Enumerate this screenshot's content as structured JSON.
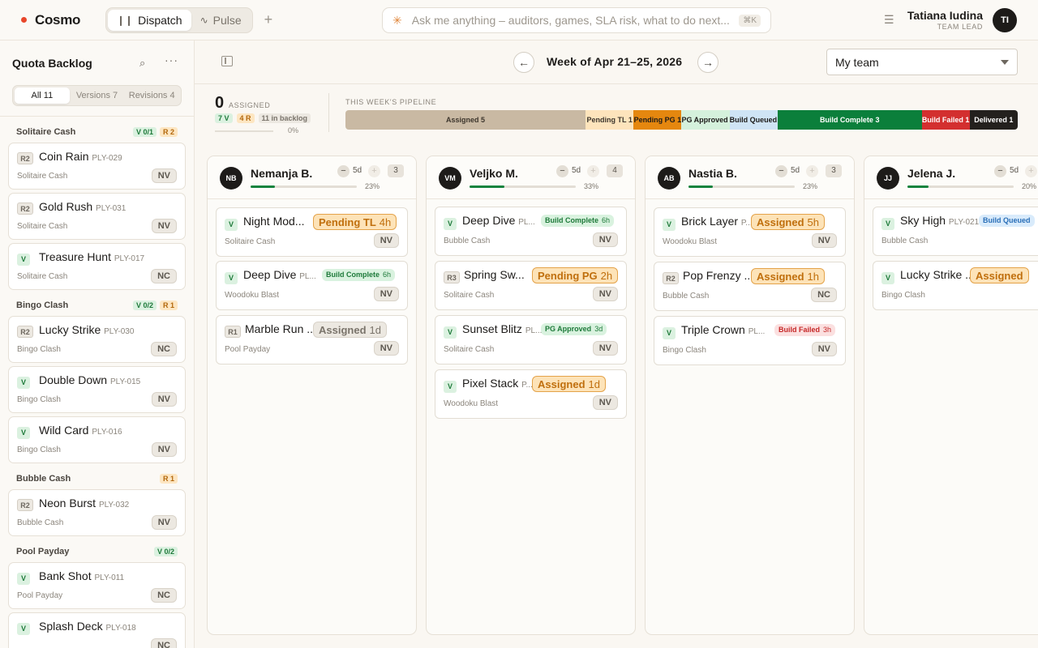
{
  "app": {
    "name": "Cosmo"
  },
  "mode_tabs": [
    {
      "label": "Dispatch",
      "icon": "bars-icon"
    },
    {
      "label": "Pulse",
      "icon": "pulse-icon"
    }
  ],
  "add_tab": "+",
  "search": {
    "placeholder": "Ask me anything – auditors, games, SLA risk, what to do next...",
    "shortcut": "⌘K"
  },
  "user": {
    "name": "Tatiana Iudina",
    "role": "TEAM LEAD",
    "initials": "TI"
  },
  "sidebar": {
    "title": "Quota Backlog",
    "filters": [
      "All 11",
      "Versions 7",
      "Revisions 4"
    ],
    "groups": [
      {
        "name": "Solitaire Cash",
        "badges": [
          {
            "type": "v",
            "text": "V 0/1"
          },
          {
            "type": "r",
            "text": "R 2"
          }
        ],
        "items": [
          {
            "tag": "R2",
            "title": "Coin Rain",
            "code": "PLY-029",
            "game": "Solitaire Cash",
            "pill": "NV"
          },
          {
            "tag": "R2",
            "title": "Gold Rush",
            "code": "PLY-031",
            "game": "Solitaire Cash",
            "pill": "NV"
          },
          {
            "tag": "V",
            "title": "Treasure Hunt",
            "code": "PLY-017",
            "game": "Solitaire Cash",
            "pill": "NC"
          }
        ]
      },
      {
        "name": "Bingo Clash",
        "badges": [
          {
            "type": "v",
            "text": "V 0/2"
          },
          {
            "type": "r",
            "text": "R 1"
          }
        ],
        "items": [
          {
            "tag": "R2",
            "title": "Lucky Strike",
            "code": "PLY-030",
            "game": "Bingo Clash",
            "pill": "NC"
          },
          {
            "tag": "V",
            "title": "Double Down",
            "code": "PLY-015",
            "game": "Bingo Clash",
            "pill": "NV"
          },
          {
            "tag": "V",
            "title": "Wild Card",
            "code": "PLY-016",
            "game": "Bingo Clash",
            "pill": "NV"
          }
        ]
      },
      {
        "name": "Bubble Cash",
        "badges": [
          {
            "type": "r",
            "text": "R 1"
          }
        ],
        "items": [
          {
            "tag": "R2",
            "title": "Neon Burst",
            "code": "PLY-032",
            "game": "Bubble Cash",
            "pill": "NV"
          }
        ]
      },
      {
        "name": "Pool Payday",
        "badges": [
          {
            "type": "v",
            "text": "V 0/2"
          }
        ],
        "items": [
          {
            "tag": "V",
            "title": "Bank Shot",
            "code": "PLY-011",
            "game": "Pool Payday",
            "pill": "NC"
          },
          {
            "tag": "V",
            "title": "Splash Deck",
            "code": "PLY-018",
            "game": "",
            "pill": "NC"
          }
        ]
      }
    ]
  },
  "week": {
    "label": "Week of Apr 21–25, 2026",
    "prev": "←",
    "next": "→"
  },
  "team_select": {
    "value": "My team"
  },
  "assigned": {
    "count": "0",
    "label": "ASSIGNED",
    "v": "7 V",
    "r": "4 R",
    "backlog": "11 in backlog",
    "pct": "0%",
    "progress": 0
  },
  "pipeline": {
    "label": "THIS WEEK'S PIPELINE",
    "segments": [
      {
        "label": "Assigned 5",
        "count": 5,
        "bg": "#c9b9a3",
        "fg": "#3d362d"
      },
      {
        "label": "Pending TL 1",
        "count": 1,
        "bg": "#fde4bc",
        "fg": "#3d362d"
      },
      {
        "label": "Pending PG 1",
        "count": 1,
        "bg": "#e5870f",
        "fg": "#1d1b19"
      },
      {
        "label": "PG Approved 1",
        "count": 1,
        "bg": "#d5f1dc",
        "fg": "#1d1b19"
      },
      {
        "label": "Build Queued 1",
        "count": 1,
        "bg": "#cfe4f5",
        "fg": "#1d1b19"
      },
      {
        "label": "Build Complete 3",
        "count": 3,
        "bg": "#0b7f3b",
        "fg": "#ffffff"
      },
      {
        "label": "Build Failed 1",
        "count": 1,
        "bg": "#d32f2f",
        "fg": "#ffffff"
      },
      {
        "label": "Delivered 1",
        "count": 1,
        "bg": "#23201d",
        "fg": "#ffffff"
      }
    ]
  },
  "columns": [
    {
      "initials": "NB",
      "name": "Nemanja B.",
      "days": "5d",
      "count": "3",
      "pct": "23%",
      "progress": 0.23,
      "cards": [
        {
          "tag": "V",
          "title": "Night Mod...",
          "code": "",
          "game": "Solitaire Cash",
          "pill": "NV",
          "status": "Pending TL",
          "time": "4h",
          "style": "pend",
          "size": "big"
        },
        {
          "tag": "V",
          "title": "Deep Dive",
          "code": "PL...",
          "game": "Woodoku Blast",
          "pill": "NV",
          "status": "Build Complete",
          "time": "6h",
          "style": "bc",
          "size": "sm"
        },
        {
          "tag": "R1",
          "title": "Marble Run ...",
          "code": "",
          "game": "Pool Payday",
          "pill": "NV",
          "status": "Assigned",
          "time": "1d",
          "style": "asg-g",
          "size": "big"
        }
      ]
    },
    {
      "initials": "VM",
      "name": "Veljko M.",
      "days": "5d",
      "count": "4",
      "pct": "33%",
      "progress": 0.33,
      "cards": [
        {
          "tag": "V",
          "title": "Deep Dive",
          "code": "PL...",
          "game": "Bubble Cash",
          "pill": "NV",
          "status": "Build Complete",
          "time": "6h",
          "style": "bc",
          "size": "sm"
        },
        {
          "tag": "R3",
          "title": "Spring Sw...",
          "code": "",
          "game": "Solitaire Cash",
          "pill": "NV",
          "status": "Pending PG",
          "time": "2h",
          "style": "pend",
          "size": "big"
        },
        {
          "tag": "V",
          "title": "Sunset Blitz",
          "code": "PL...",
          "game": "Solitaire Cash",
          "pill": "NV",
          "status": "PG Approved",
          "time": "3d",
          "style": "pg",
          "size": "sm"
        },
        {
          "tag": "V",
          "title": "Pixel Stack",
          "code": "P...",
          "game": "Woodoku Blast",
          "pill": "NV",
          "status": "Assigned",
          "time": "1d",
          "style": "asg-o",
          "size": "big"
        }
      ]
    },
    {
      "initials": "AB",
      "name": "Nastia B.",
      "days": "5d",
      "count": "3",
      "pct": "23%",
      "progress": 0.23,
      "cards": [
        {
          "tag": "V",
          "title": "Brick Layer",
          "code": "P...",
          "game": "Woodoku Blast",
          "pill": "NV",
          "status": "Assigned",
          "time": "5h",
          "style": "asg-o",
          "size": "big"
        },
        {
          "tag": "R2",
          "title": "Pop Frenzy ...",
          "code": "",
          "game": "Bubble Cash",
          "pill": "NC",
          "status": "Assigned",
          "time": "1h",
          "style": "asg-o",
          "size": "big"
        },
        {
          "tag": "V",
          "title": "Triple Crown",
          "code": "PL...",
          "game": "Bingo Clash",
          "pill": "NV",
          "status": "Build Failed",
          "time": "3h",
          "style": "bf",
          "size": "sm"
        }
      ]
    },
    {
      "initials": "JJ",
      "name": "Jelena J.",
      "days": "5d",
      "count": "",
      "pct": "20%",
      "progress": 0.2,
      "cards": [
        {
          "tag": "V",
          "title": "Sky High",
          "code": "PLY-021",
          "game": "Bubble Cash",
          "pill": "",
          "status": "Build Queued",
          "time": "",
          "style": "bq",
          "size": "sm"
        },
        {
          "tag": "V",
          "title": "Lucky Strike ...",
          "code": "",
          "game": "Bingo Clash",
          "pill": "",
          "status": "Assigned",
          "time": "",
          "style": "asg-o",
          "size": "big"
        }
      ]
    }
  ]
}
